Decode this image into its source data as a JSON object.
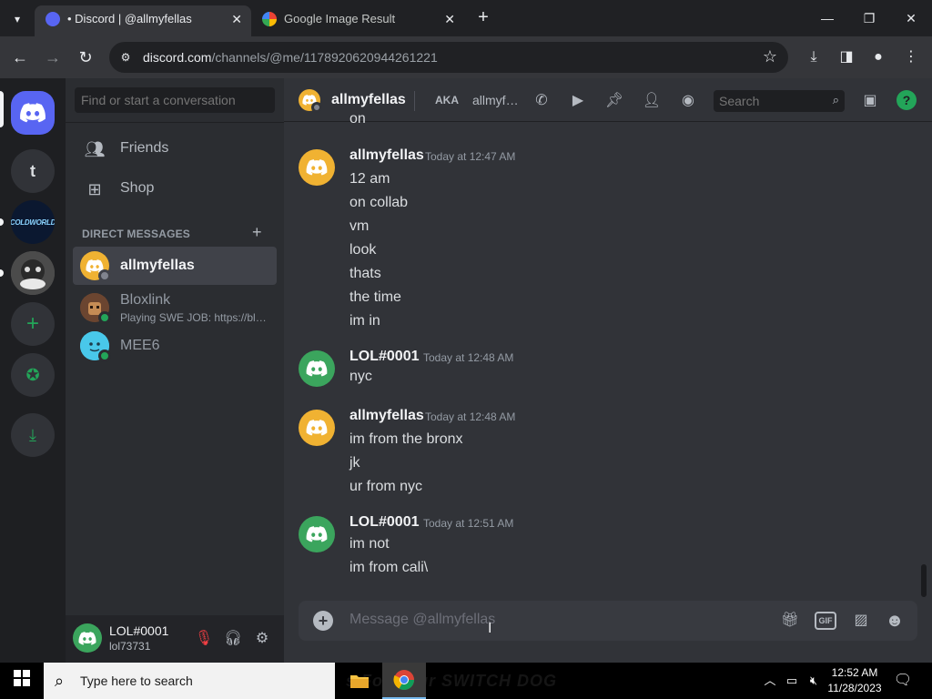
{
  "browser": {
    "tabs": [
      {
        "title": "• Discord | @allmyfellas",
        "active": true
      },
      {
        "title": "Google Image Result",
        "active": false
      }
    ],
    "url_host": "discord.com",
    "url_path": "/channels/@me/1178920620944261221"
  },
  "discord": {
    "guilds": [
      {
        "name": "Direct Messages",
        "icon": "discord-logo-icon"
      },
      {
        "name": "t",
        "letter": "t"
      },
      {
        "name": "COLDWORLD",
        "letter": "COLDWORLD"
      },
      {
        "name": "server-avatar",
        "icon": "server-avatar-icon"
      },
      {
        "name": "Add a Server",
        "icon": "plus-icon"
      },
      {
        "name": "Explore Discoverable Servers",
        "icon": "compass-icon"
      },
      {
        "name": "Download Apps",
        "icon": "download-icon"
      }
    ],
    "dm_search_placeholder": "Find or start a conversation",
    "nav": [
      {
        "label": "Friends",
        "icon": "friends-icon"
      },
      {
        "label": "Shop",
        "icon": "shop-icon"
      }
    ],
    "dm_header": "DIRECT MESSAGES",
    "dms": [
      {
        "name": "allmyfellas",
        "sub": "",
        "selected": true,
        "avatar_color": "#f0b232",
        "status": "offline"
      },
      {
        "name": "Bloxlink",
        "sub": "Playing SWE JOB: https://blo...",
        "selected": false,
        "avatar_color": "#5b3a29",
        "status": "online"
      },
      {
        "name": "MEE6",
        "sub": "",
        "selected": false,
        "avatar_color": "#45c7e8",
        "status": "online"
      }
    ],
    "user": {
      "name": "LOL#0001",
      "tag": "lol73731"
    },
    "chat_header": {
      "name": "allmyfellas",
      "aka_label": "AKA",
      "alias": "allmyfellas",
      "search_placeholder": "Search"
    },
    "messages": [
      {
        "author": "allmyfellas",
        "timestamp": "Today at 12:47 AM",
        "avatar_color": "#f0b232",
        "lines": [
          "12 am",
          "on collab",
          "vm",
          "look",
          "thats",
          "the time",
          "im in"
        ]
      },
      {
        "author": "LOL#0001",
        "timestamp": "Today at 12:48 AM",
        "avatar_color": "#3ba55d",
        "lines": [
          "nyc"
        ]
      },
      {
        "author": "allmyfellas",
        "timestamp": "Today at 12:48 AM",
        "avatar_color": "#f0b232",
        "lines": [
          "im from the bronx",
          "jk",
          "ur from nyc"
        ]
      },
      {
        "author": "LOL#0001",
        "timestamp": "Today at 12:51 AM",
        "avatar_color": "#3ba55d",
        "lines": [
          "im not",
          "im from cali\\"
        ]
      }
    ],
    "truncated_top_line": "on",
    "composer_placeholder": "Message @allmyfellas",
    "gif_label": "GIF"
  },
  "taskbar": {
    "search_placeholder": "Type here to search",
    "wallpaper_text": "s For Your SWITCH DOG",
    "time": "12:52 AM",
    "date": "11/28/2023"
  },
  "colors": {
    "blurple": "#5865f2",
    "green": "#23a559",
    "yellow": "#f0b232"
  }
}
